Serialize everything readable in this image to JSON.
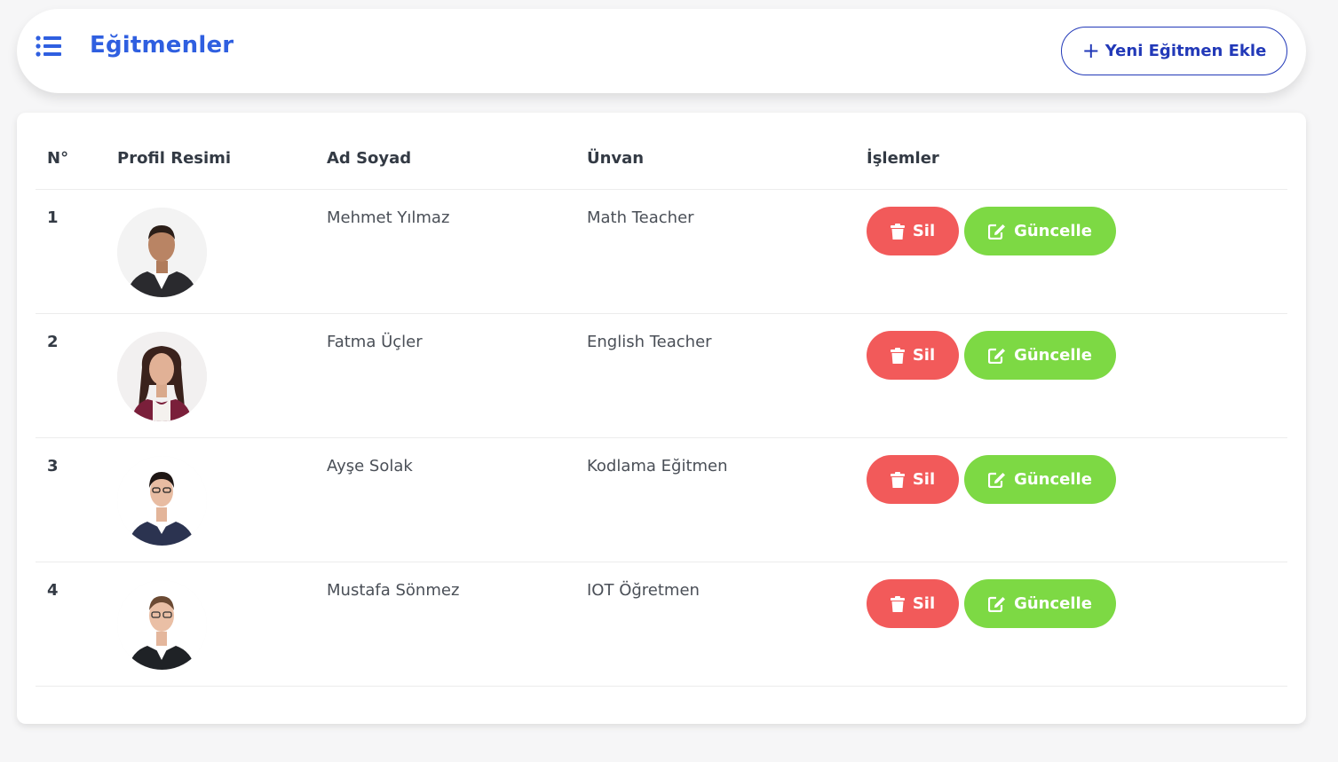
{
  "header": {
    "title": "Eğitmenler",
    "add_button_label": "Yeni Eğitmen Ekle",
    "add_button_plus": "+"
  },
  "table": {
    "columns": [
      "N°",
      "Profil Resimi",
      "Ad Soyad",
      "Ünvan",
      "İşlemler"
    ],
    "rows": [
      {
        "no": "1",
        "name": "Mehmet Yılmaz",
        "title": "Math Teacher"
      },
      {
        "no": "2",
        "name": "Fatma Üçler",
        "title": "English Teacher"
      },
      {
        "no": "3",
        "name": "Ayşe Solak",
        "title": "Kodlama Eğitmen"
      },
      {
        "no": "4",
        "name": "Mustafa Sönmez",
        "title": "IOT Öğretmen"
      }
    ],
    "delete_label": "Sil",
    "update_label": "Güncelle"
  },
  "icons": {
    "menu": "list-icon",
    "delete": "trash-icon",
    "update": "edit-icon"
  },
  "colors": {
    "brand": "#2f5fe0",
    "add_button": "#2239b8",
    "delete_button": "#f25a5a",
    "update_button": "#7dd944"
  }
}
